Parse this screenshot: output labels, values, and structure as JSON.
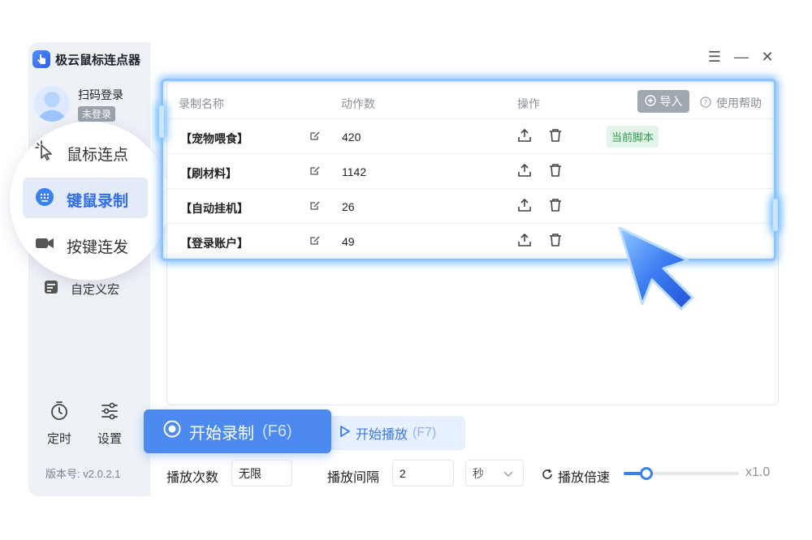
{
  "app": {
    "title": "极云鼠标连点器",
    "logo_icon": "hand-pointer-icon"
  },
  "window_controls": {
    "menu": "☰",
    "minimize": "—",
    "close": "✕"
  },
  "user": {
    "login_label": "扫码登录",
    "status": "未登录"
  },
  "sidebar": {
    "items": [
      {
        "label": "鼠标连点",
        "icon": "cursor-click-icon"
      },
      {
        "label": "键鼠录制",
        "icon": "keyboard-icon",
        "active": true
      },
      {
        "label": "按键连发",
        "icon": "video-camera-icon"
      },
      {
        "label": "自定义宏",
        "icon": "macro-icon"
      }
    ],
    "bottom": [
      {
        "label": "定时",
        "icon": "timer-icon"
      },
      {
        "label": "设置",
        "icon": "sliders-icon"
      }
    ],
    "version": "版本号: v2.0.2.1"
  },
  "table": {
    "headers": {
      "name": "录制名称",
      "actions_count": "动作数",
      "operations": "操作"
    },
    "import_label": "导入",
    "help_label": "使用帮助",
    "rows": [
      {
        "name": "【宠物喂食】",
        "count": "420",
        "tag": "当前脚本"
      },
      {
        "name": "【刷材料】",
        "count": "1142"
      },
      {
        "name": "【自动挂机】",
        "count": "26"
      },
      {
        "name": "【登录账户】",
        "count": "49"
      }
    ]
  },
  "controls": {
    "record_label": "开始录制",
    "record_key": "(F6)",
    "play_label": "开始播放",
    "play_key": "(F7)",
    "play_count_label": "播放次数",
    "play_count_value": "无限",
    "interval_label": "播放间隔",
    "interval_value": "2",
    "interval_unit": "秒",
    "speed_label": "播放倍速",
    "speed_value": "x1.0",
    "speed_level": 0.2
  },
  "colors": {
    "accent": "#4d8af0",
    "tag_green": "#2f9a4a"
  }
}
